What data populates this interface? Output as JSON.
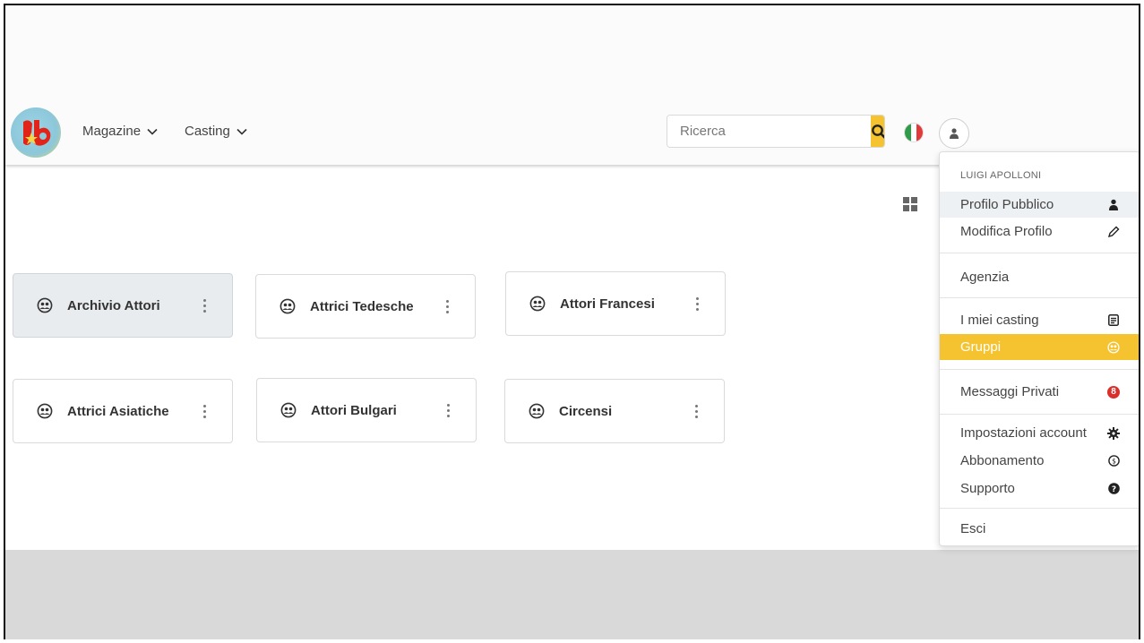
{
  "nav": {
    "magazine_label": "Magazine",
    "casting_label": "Casting"
  },
  "search": {
    "placeholder": "Ricerca",
    "value": ""
  },
  "groups": [
    {
      "label": "Archivio Attori",
      "active": true
    },
    {
      "label": "Attrici Tedesche",
      "active": false
    },
    {
      "label": "Attori Francesi",
      "active": false
    },
    {
      "label": "Attrici Asiatiche",
      "active": false
    },
    {
      "label": "Attori Bulgari",
      "active": false
    },
    {
      "label": "Circensi",
      "active": false
    }
  ],
  "user_menu": {
    "user_name": "LUIGI APOLLONI",
    "items": [
      {
        "label": "Profilo Pubblico",
        "icon": "user-icon"
      },
      {
        "label": "Modifica Profilo",
        "icon": "pencil-icon"
      },
      {
        "label": "Agenzia",
        "icon": ""
      },
      {
        "label": "I miei casting",
        "icon": "document-icon"
      },
      {
        "label": "Gruppi",
        "icon": "groups-icon"
      },
      {
        "label": "Messaggi Privati",
        "icon": "badge",
        "badge": "8"
      },
      {
        "label": "Impostazioni account",
        "icon": "gear-icon"
      },
      {
        "label": "Abbonamento",
        "icon": "dollar-circle-icon"
      },
      {
        "label": "Supporto",
        "icon": "question-icon"
      },
      {
        "label": "Esci",
        "icon": ""
      }
    ]
  },
  "colors": {
    "accent": "#f5c330",
    "badge": "#d9302c",
    "active_card": "#e8ecef"
  }
}
